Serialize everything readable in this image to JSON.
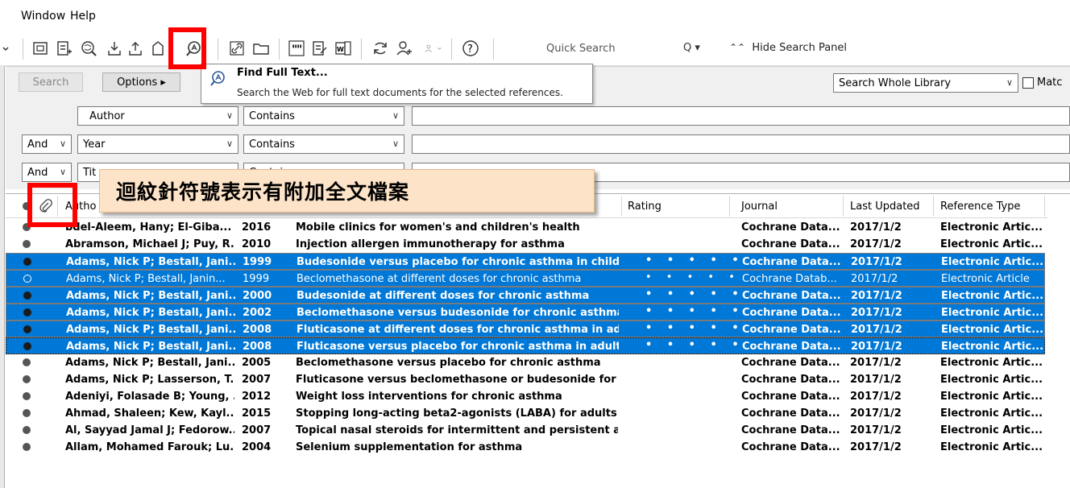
{
  "menu": {
    "window": "Window",
    "help": "Help"
  },
  "toolbar": {
    "quick_search": "Quick Search",
    "search_icon": "Q ▾",
    "hide_panel": "Hide Search Panel",
    "icons": [
      "chevron-down-icon",
      "new-library-icon",
      "import-icon",
      "online-search-icon",
      "download-icon",
      "upload-icon",
      "find-full-text-icon",
      "link-icon",
      "folder-icon",
      "insert-citation-icon",
      "format-bibliography-icon",
      "word-icon",
      "sync-icon",
      "share-icon",
      "groups-icon",
      "help-icon"
    ]
  },
  "tooltip": {
    "title": "Find Full Text...",
    "description": "Search the Web for full text documents for the selected references."
  },
  "search_panel": {
    "search_btn": "Search",
    "options_btn": "Options ▸",
    "scope": "Search Whole Library",
    "match_label": "Matc",
    "rows": [
      {
        "bool": "",
        "field": "Author",
        "op": "Contains"
      },
      {
        "bool": "And",
        "field": "Year",
        "op": "Contains"
      },
      {
        "bool": "And",
        "field": "Tit",
        "op": "Contains"
      }
    ]
  },
  "callout": "迴紋針符號表示有附加全文檔案",
  "columns": {
    "author": "Autho",
    "rating": "Rating",
    "journal": "Journal",
    "last_updated": "Last Updated",
    "ref_type": "Reference Type"
  },
  "rows": [
    {
      "author": "bdel-Aleem, Hany; El-Giba...",
      "year": "2016",
      "title": "Mobile clinics for women's and children's health",
      "rating": "",
      "journal": "Cochrane Data...",
      "updated": "2017/1/2",
      "type": "Electronic Artic...",
      "state": "normal"
    },
    {
      "author": "Abramson, Michael J; Puy, R...",
      "year": "2010",
      "title": "Injection allergen immunotherapy for asthma",
      "rating": "",
      "journal": "Cochrane Data...",
      "updated": "2017/1/2",
      "type": "Electronic Artic...",
      "state": "normal"
    },
    {
      "author": "Adams, Nick P; Bestall, Jani...",
      "year": "1999",
      "title": "Budesonide versus placebo for chronic asthma in childr...",
      "rating": "• • • • •",
      "journal": "Cochrane Data...",
      "updated": "2017/1/2",
      "type": "Electronic Artic...",
      "state": "selected"
    },
    {
      "author": "Adams, Nick P; Bestall, Janin...",
      "year": "1999",
      "title": "Beclomethasone at different doses for chronic asthma",
      "rating": "• • • • •",
      "journal": "Cochrane Datab...",
      "updated": "2017/1/2",
      "type": "Electronic Article",
      "state": "selected-light"
    },
    {
      "author": "Adams, Nick P; Bestall, Jani...",
      "year": "2000",
      "title": "Budesonide at different doses for chronic asthma",
      "rating": "• • • • •",
      "journal": "Cochrane Data...",
      "updated": "2017/1/2",
      "type": "Electronic Artic...",
      "state": "selected"
    },
    {
      "author": "Adams, Nick P; Bestall, Jani...",
      "year": "2002",
      "title": "Beclomethasone versus budesonide for chronic asthma",
      "rating": "• • • • •",
      "journal": "Cochrane Data...",
      "updated": "2017/1/2",
      "type": "Electronic Artic...",
      "state": "selected"
    },
    {
      "author": "Adams, Nick P; Bestall, Jani...",
      "year": "2008",
      "title": "Fluticasone at different doses for chronic asthma in adu...",
      "rating": "• • • • •",
      "journal": "Cochrane Data...",
      "updated": "2017/1/2",
      "type": "Electronic Artic...",
      "state": "selected"
    },
    {
      "author": "Adams, Nick P; Bestall, Jani...",
      "year": "2008",
      "title": "Fluticasone versus placebo for chronic asthma in adults ...",
      "rating": "• • • • •",
      "journal": "Cochrane Data...",
      "updated": "2017/1/2",
      "type": "Electronic Artic...",
      "state": "selected-focus"
    },
    {
      "author": "Adams, Nick P; Bestall, Jani...",
      "year": "2005",
      "title": "Beclomethasone versus placebo for chronic asthma",
      "rating": "",
      "journal": "Cochrane Data...",
      "updated": "2017/1/2",
      "type": "Electronic Artic...",
      "state": "normal"
    },
    {
      "author": "Adams, Nick P; Lasserson, T...",
      "year": "2007",
      "title": "Fluticasone versus beclomethasone or budesonide for c...",
      "rating": "",
      "journal": "Cochrane Data...",
      "updated": "2017/1/2",
      "type": "Electronic Artic...",
      "state": "normal"
    },
    {
      "author": "Adeniyi, Folasade B; Young, ...",
      "year": "2012",
      "title": "Weight loss interventions for chronic asthma",
      "rating": "",
      "journal": "Cochrane Data...",
      "updated": "2017/1/2",
      "type": "Electronic Artic...",
      "state": "normal"
    },
    {
      "author": "Ahmad, Shaleen; Kew, Kayl...",
      "year": "2015",
      "title": "Stopping long-acting beta2-agonists (LABA) for adults ...",
      "rating": "",
      "journal": "Cochrane Data...",
      "updated": "2017/1/2",
      "type": "Electronic Artic...",
      "state": "normal"
    },
    {
      "author": "Al, Sayyad Jamal J; Fedorow...",
      "year": "2007",
      "title": "Topical nasal steroids for intermittent and persistent all...",
      "rating": "",
      "journal": "Cochrane Data...",
      "updated": "2017/1/2",
      "type": "Electronic Artic...",
      "state": "normal"
    },
    {
      "author": "Allam, Mohamed Farouk; Lu...",
      "year": "2004",
      "title": "Selenium supplementation for asthma",
      "rating": "",
      "journal": "Cochrane Data...",
      "updated": "2017/1/2",
      "type": "Electronic Artic...",
      "state": "normal"
    }
  ]
}
